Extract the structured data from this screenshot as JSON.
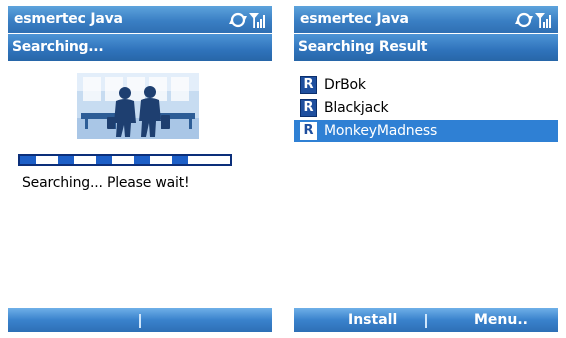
{
  "left_screen": {
    "app_title": "esmertec Java",
    "header": "Searching...",
    "progress": 0.84,
    "status": "Searching... Please wait!",
    "softkeys": {
      "left": "",
      "right": ""
    }
  },
  "right_screen": {
    "app_title": "esmertec Java",
    "header": "Searching Result",
    "items": [
      {
        "badge": "R",
        "label": "DrBok",
        "selected": false
      },
      {
        "badge": "R",
        "label": "Blackjack",
        "selected": false
      },
      {
        "badge": "R",
        "label": "MonkeyMadness",
        "selected": true
      }
    ],
    "softkeys": {
      "left": "Install",
      "right": "Menu.."
    }
  },
  "colors": {
    "title_bar": "#3a7fc4",
    "selection": "#2f80d4",
    "progress_fill": "#1d5fc7",
    "badge": "#1f4f9e"
  },
  "icons": [
    "sync-icon",
    "signal-strength-icon",
    "app-badge-icon"
  ]
}
